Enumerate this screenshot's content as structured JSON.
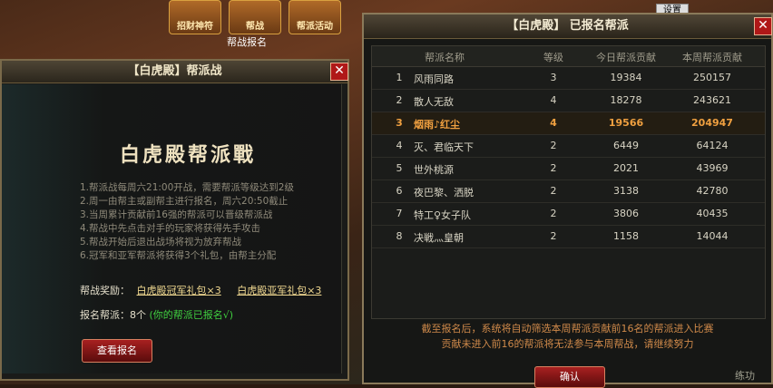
{
  "top_bar": {
    "buttons": [
      "招财神符",
      "帮战",
      "帮派活动"
    ],
    "hint": "帮战报名",
    "settings_label": "设置"
  },
  "left_panel": {
    "title": "【白虎殿】帮派战",
    "close": "✕",
    "big_title": "白虎殿帮派戰",
    "rules": [
      "1.帮派战每周六21:00开战，需要帮派等级达到2级",
      "2.周一由帮主或副帮主进行报名，周六20:50截止",
      "3.当周累计贡献前16强的帮派可以晋级帮派战",
      "4.帮战中先点击对手的玩家将获得先手攻击",
      "5.帮战开始后退出战场将视为放弃帮战",
      "6.冠军和亚军帮派将获得3个礼包，由帮主分配"
    ],
    "reward_label": "帮战奖励：",
    "reward_champion": "白虎殿冠军礼包×3",
    "reward_runnerup": "白虎殿亚军礼包×3",
    "signup_label": "报名帮派：8个",
    "signup_status": "(你的帮派已报名√)",
    "view_button": "查看报名"
  },
  "right_panel": {
    "title": "【白虎殿】 已报名帮派",
    "close": "✕",
    "columns": [
      "帮派名称",
      "等级",
      "今日帮派贡献",
      "本周帮派贡献"
    ],
    "rows": [
      {
        "rank": "1",
        "name": "风雨同路",
        "level": "3",
        "today": "19384",
        "week": "250157"
      },
      {
        "rank": "2",
        "name": "散人无敌",
        "level": "4",
        "today": "18278",
        "week": "243621"
      },
      {
        "rank": "3",
        "name": "烟雨♪红尘",
        "level": "4",
        "today": "19566",
        "week": "204947"
      },
      {
        "rank": "4",
        "name": "灭、君临天下",
        "level": "2",
        "today": "6449",
        "week": "64124"
      },
      {
        "rank": "5",
        "name": "世外桃源",
        "level": "2",
        "today": "2021",
        "week": "43969"
      },
      {
        "rank": "6",
        "name": "夜巴黎、洒脱",
        "level": "2",
        "today": "3138",
        "week": "42780"
      },
      {
        "rank": "7",
        "name": "特工♀女子队",
        "level": "2",
        "today": "3806",
        "week": "40435"
      },
      {
        "rank": "8",
        "name": "决戦灬皇朝",
        "level": "2",
        "today": "1158",
        "week": "14044"
      }
    ],
    "notice": [
      "截至报名后，系统将自动筛选本周帮派贡献前16名的帮派进入比赛",
      "贡献未进入前16的帮派将无法参与本周帮战，请继续努力"
    ],
    "ok_button": "确认"
  },
  "practice_label": "练功"
}
